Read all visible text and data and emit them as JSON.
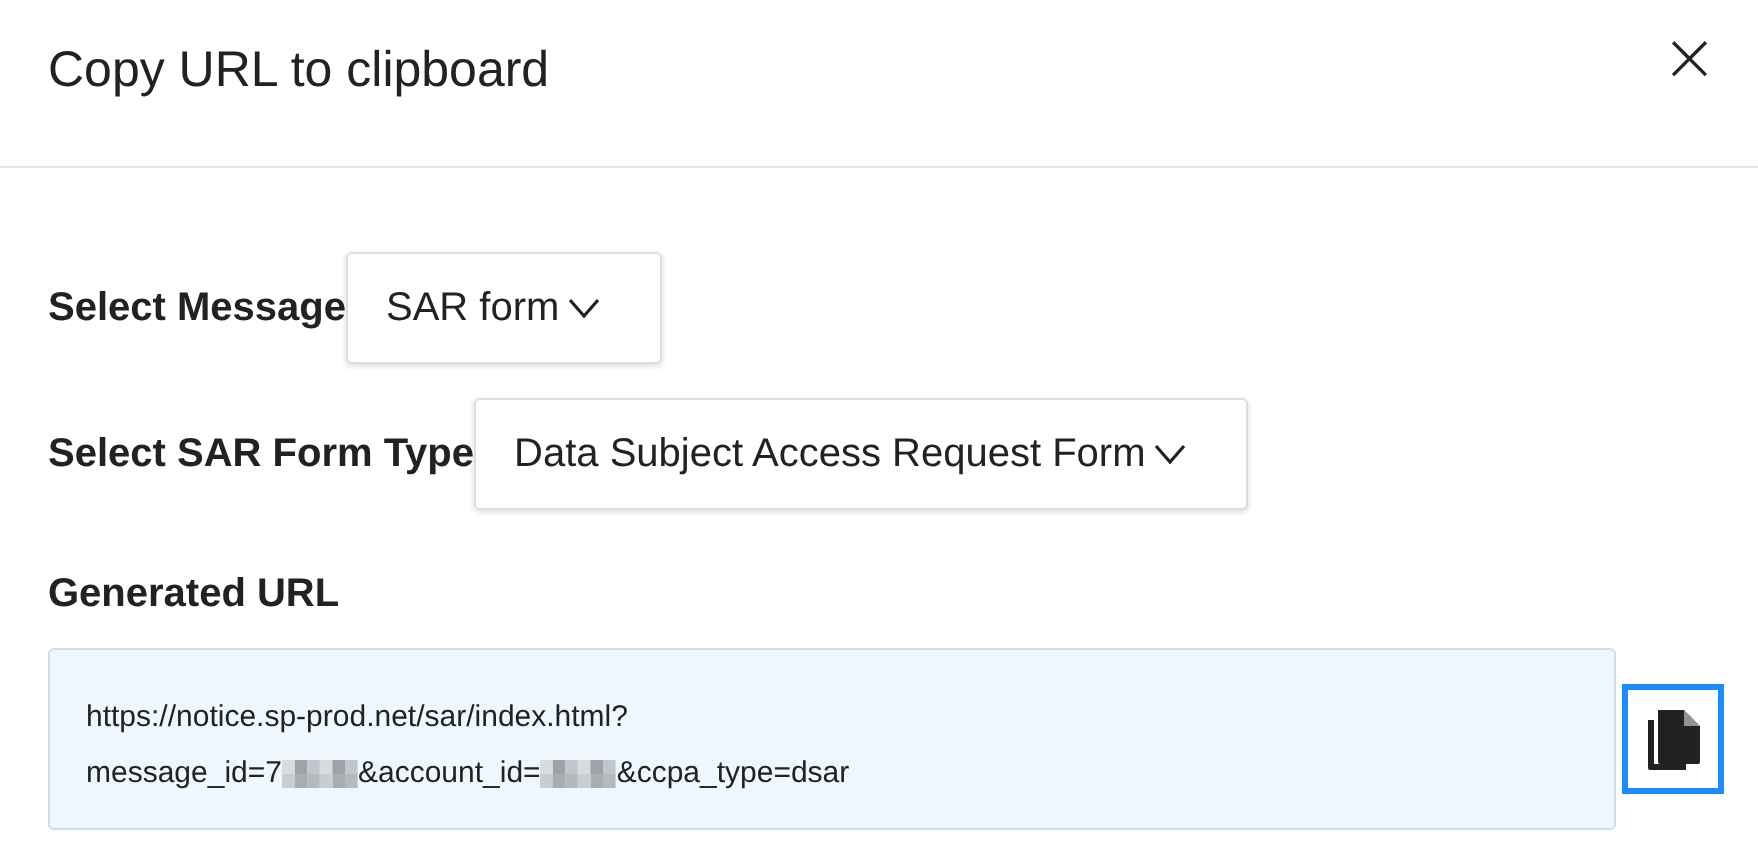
{
  "dialog": {
    "title": "Copy URL to clipboard",
    "close": "×"
  },
  "selects": [
    {
      "label": "Select Message",
      "value": "SAR form"
    },
    {
      "label": "Select SAR Form Type",
      "value": "Data Subject Access Request Form"
    }
  ],
  "generated_url": {
    "label": "Generated URL",
    "line_1": "https://notice.sp-prod.net/sar/index.html?",
    "line_2": [
      {
        "kind": "text",
        "text": "message_id=7"
      },
      {
        "kind": "redacted"
      },
      {
        "kind": "text",
        "text": "&account_id="
      },
      {
        "kind": "redacted"
      },
      {
        "kind": "text",
        "text": "&ccpa_type=dsar"
      }
    ]
  }
}
